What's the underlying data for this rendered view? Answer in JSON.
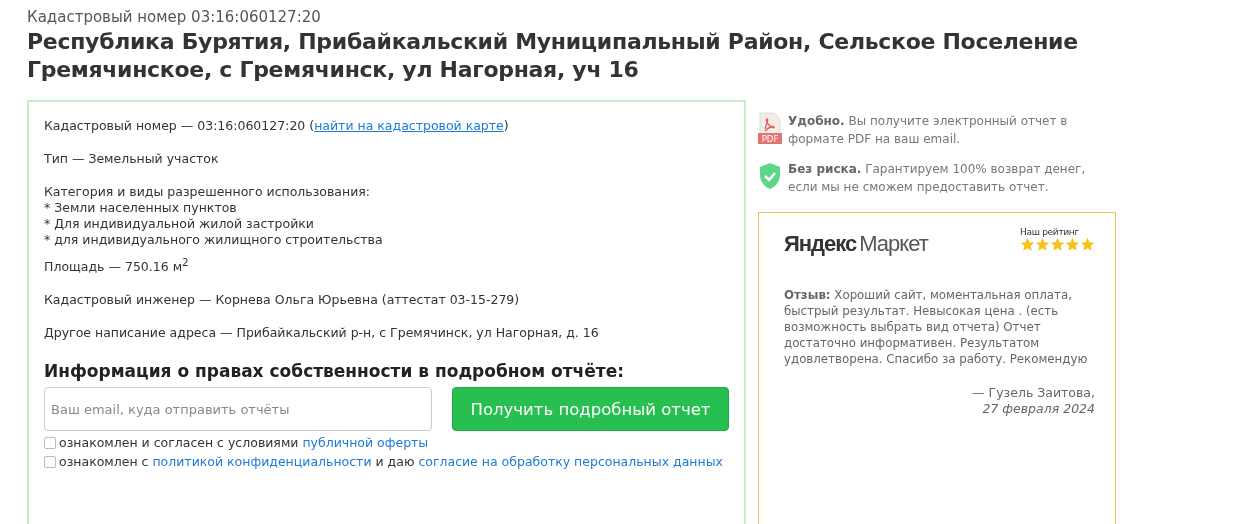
{
  "header": {
    "cadastral_line": "Кадастровый номер 03:16:060127:20",
    "title": "Республика Бурятия, Прибайкальский Муниципальный Район, Сельское Поселение Гремячинское, с Гремячинск, ул Нагорная, уч 16"
  },
  "details": {
    "cadastral": {
      "text": "Кадастровый номер — 03:16:060127:20 (",
      "link": "найти на кадастровой карте",
      "after": ")"
    },
    "lines": [
      {
        "kind": "para",
        "text": "Тип — Земельный участок"
      },
      {
        "kind": "list",
        "text": "Категория и виды разрешенного использования:",
        "items": [
          "* Земли населенных пунктов",
          "* Для индивидуальной жилой застройки",
          "* для индивидуального жилищного строительства"
        ]
      },
      {
        "kind": "tight",
        "text": "Площадь — 750.16 м$^{2}$"
      },
      {
        "kind": "para",
        "text": "Кадастровый инженер — Корнева Ольга Юрьевна (аттестат 03-15-279)"
      },
      {
        "kind": "para",
        "text": "Другое написание адреса — Прибайкальский р-н, с Гремячинск, ул Нагорная, д. 16"
      }
    ]
  },
  "order": {
    "heading": "Информация о правах собственности в подробном отчёте:",
    "email": {
      "placeholder": "Ваш email, куда отправить отчёты"
    },
    "button": "Получить подробный отчет",
    "agreements": [
      {
        "checked": false,
        "parts": [
          {
            "kind": "text",
            "text": "ознакомлен и согласен с условиями "
          },
          {
            "kind": "link",
            "text": "публичной оферты"
          }
        ]
      },
      {
        "checked": false,
        "parts": [
          {
            "kind": "text",
            "text": "ознакомлен с "
          },
          {
            "kind": "link",
            "text": "политикой конфиденциальности"
          },
          {
            "kind": "text",
            "text": " и даю "
          },
          {
            "kind": "link",
            "text": "согласие на обработку персональных данных"
          }
        ]
      }
    ]
  },
  "benefits": [
    {
      "kind": "pdf",
      "icon_label": "PDF",
      "text": "**Удобно.** Вы получите электронный отчет в формате PDF на ваш email."
    },
    {
      "kind": "shield",
      "text": "**Без риска.** Гарантируем 100% возврат денег, если мы не сможем предоставить отчет."
    }
  ],
  "review": {
    "logo": [
      "Яндекс",
      "Маркет"
    ],
    "rating_label": "Наш рейтинг",
    "stars": 5,
    "text": "**Отзыв:** Хороший сайт, моментальная оплата, быстрый результат. Невысокая цена . (есть возможность выбрать вид отчета) Отчет достаточно информативен. Результатом удовлетворена. Спасибо за работу. Рекомендую",
    "author": "— Гузель Заитова,",
    "date": "27 февраля 2024"
  }
}
